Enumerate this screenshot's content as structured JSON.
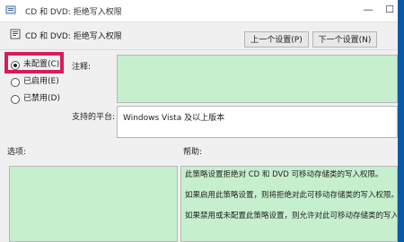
{
  "window": {
    "title": "CD 和 DVD: 拒绝写入权限",
    "controls": [
      "minimize",
      "maximize"
    ]
  },
  "header": {
    "title": "CD 和 DVD: 拒绝写入权限",
    "prev_button": "上一个设置(P)",
    "next_button": "下一个设置(N)"
  },
  "options": {
    "items": [
      {
        "label": "未配置(C)",
        "checked": true
      },
      {
        "label": "已启用(E)",
        "checked": false
      },
      {
        "label": "已禁用(D)",
        "checked": false
      }
    ]
  },
  "comment": {
    "label": "注释:",
    "value": ""
  },
  "platform": {
    "label": "支持的平台:",
    "value": "Windows Vista 及以上版本"
  },
  "sections": {
    "options_label": "选项:",
    "help_label": "帮助:"
  },
  "help_text": [
    "此策略设置拒绝对 CD 和 DVD 可移动存储类的写入权限。",
    "如果启用此策略设置，则将拒绝对此可移动存储类的写入权限。",
    "如果禁用或未配置此策略设置，则允许对此可移动存储类的写入权"
  ],
  "colors": {
    "field_green": "#c6efce",
    "highlight": "#d81b60",
    "accent_blue": "#0a5aa8"
  }
}
